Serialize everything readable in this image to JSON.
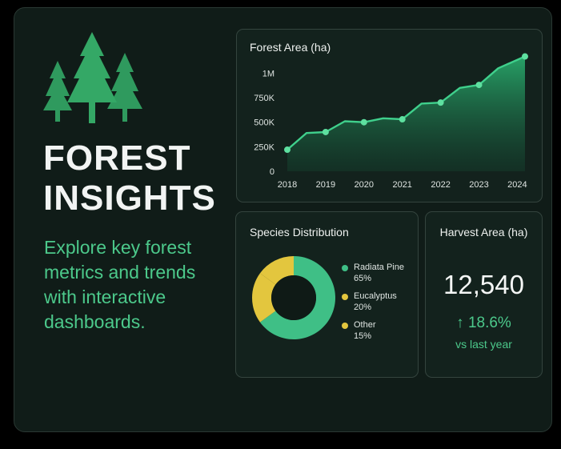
{
  "hero": {
    "title_line1": "FOREST",
    "title_line2": "INSIGHTS",
    "subtitle": "Explore key forest metrics and trends with interactive dashboards."
  },
  "icons": {
    "logo": "pine-trees-icon"
  },
  "colors": {
    "accent_green": "#4cc98b",
    "line_green": "#3fd08c",
    "eucalyptus_yellow": "#e5c840",
    "background": "#101c18"
  },
  "forest_area": {
    "title": "Forest Area (ha)",
    "chart_data": {
      "type": "area",
      "title": "Forest Area (ha)",
      "x_ticks": [
        "2018",
        "2019",
        "2020",
        "2021",
        "2022",
        "2023",
        "2024"
      ],
      "y_ticks": [
        "0",
        "250K",
        "500K",
        "750K",
        "1M"
      ],
      "y_tick_values": [
        0,
        250000,
        500000,
        750000,
        1000000
      ],
      "ylim": [
        0,
        1150000
      ],
      "xlim": [
        2018,
        2024.2
      ],
      "points": [
        {
          "x": 2018.0,
          "y": 220000
        },
        {
          "x": 2018.5,
          "y": 390000
        },
        {
          "x": 2019.0,
          "y": 400000
        },
        {
          "x": 2019.5,
          "y": 510000
        },
        {
          "x": 2020.0,
          "y": 500000
        },
        {
          "x": 2020.5,
          "y": 540000
        },
        {
          "x": 2021.0,
          "y": 530000
        },
        {
          "x": 2021.5,
          "y": 690000
        },
        {
          "x": 2022.0,
          "y": 700000
        },
        {
          "x": 2022.5,
          "y": 850000
        },
        {
          "x": 2023.0,
          "y": 880000
        },
        {
          "x": 2023.5,
          "y": 1050000
        },
        {
          "x": 2024.2,
          "y": 1170000
        }
      ],
      "marked_points": [
        0,
        2,
        4,
        6,
        8,
        10,
        12
      ],
      "grid": false,
      "legend": "none"
    }
  },
  "species": {
    "title": "Species Distribution",
    "chart_data": {
      "type": "pie",
      "donut": true,
      "slices": [
        {
          "label": "Radiata Pine",
          "value": 65,
          "display": "65%",
          "color": "#3fbf86"
        },
        {
          "label": "Eucalyptus",
          "value": 20,
          "display": "20%",
          "color": "#e3c63e"
        },
        {
          "label": "Other",
          "value": 15,
          "display": "15%",
          "color": "#e3c63e"
        }
      ],
      "legend": "right"
    }
  },
  "harvest": {
    "title": "Harvest Area (ha)",
    "value": "12,540",
    "change": "↑ 18.6%",
    "change_label": "vs last year"
  }
}
